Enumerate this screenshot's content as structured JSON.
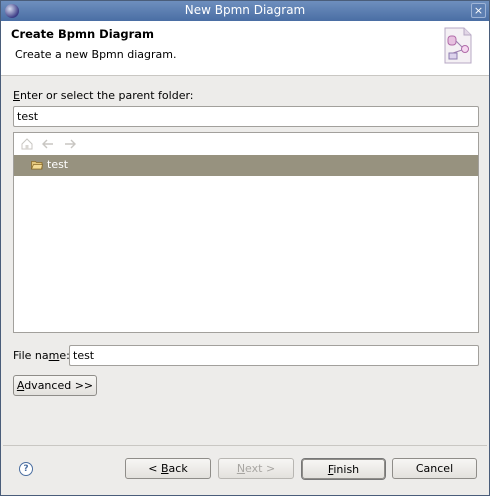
{
  "window": {
    "title": "New Bpmn Diagram"
  },
  "header": {
    "title": "Create Bpmn Diagram",
    "description": "Create a new Bpmn diagram."
  },
  "parent_folder": {
    "label_mnemonic": "E",
    "label_rest": "nter or select the parent folder:",
    "value": "test"
  },
  "tree": {
    "items": [
      {
        "label": "test",
        "selected": true,
        "icon": "folder-open-icon"
      }
    ],
    "toolbar": [
      "home-icon",
      "back-arrow-icon",
      "forward-arrow-icon"
    ]
  },
  "file_name": {
    "label_pre": "File na",
    "label_mnemonic": "m",
    "label_post": "e:",
    "value": "test"
  },
  "advanced_button": {
    "mnemonic": "A",
    "rest": "dvanced >>"
  },
  "footer": {
    "back": {
      "pre": "< ",
      "mnemonic": "B",
      "post": "ack"
    },
    "next": {
      "pre": "",
      "mnemonic": "N",
      "post": "ext >"
    },
    "finish": {
      "pre": "",
      "mnemonic": "F",
      "post": "inish"
    },
    "cancel": {
      "label": "Cancel"
    },
    "help_glyph": "?"
  },
  "colors": {
    "selection": "#97927f",
    "titlebar": "#5a7db2"
  }
}
